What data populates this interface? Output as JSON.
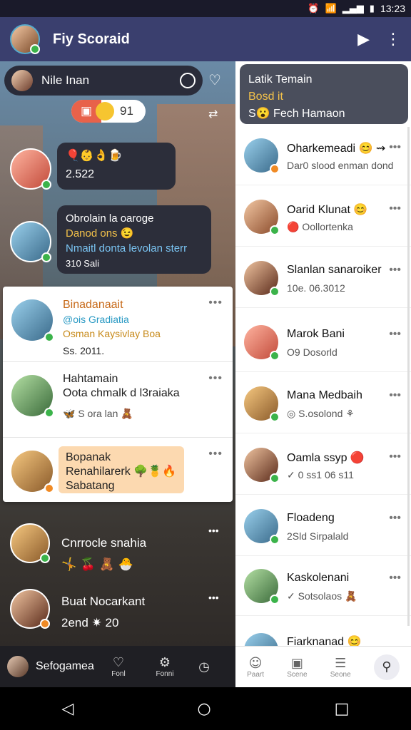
{
  "status": {
    "time": "13:23"
  },
  "header": {
    "title": "Fiy Scoraid"
  },
  "left": {
    "search_label": "Nile Inan",
    "reaction_count": "91",
    "msg1": {
      "line1": "🎈👶👌🍺",
      "line2": "2.522"
    },
    "msg2": {
      "line1": "Obrolain la oaroge",
      "line2": "Danod ons 😉",
      "line3": "Nmaitl donta levolan sterr",
      "line4": "310 Sali"
    },
    "cards": [
      {
        "l1": "Binadanaait",
        "l2": "@ois Gradiatia",
        "l3": "Osman Kaysivlay Boa",
        "l4": "Ss. 2011."
      },
      {
        "l1": "Hahtamain",
        "l2": "Oota chmalk d l3raiaka",
        "l3": "🦋 S ora lan 🧸"
      },
      {
        "l1": "Bopanak",
        "l2": "Renahilarerk 🌳🍍🔥",
        "l3": "Sabatang"
      }
    ],
    "chat1": {
      "name": "Cnrrocle snahia",
      "sub": "🤸 🍒 🧸 🐣"
    },
    "chat2": {
      "name": "Buat Nocarkant",
      "sub": "2end ✷ 20"
    },
    "footer": {
      "name": "Sefogamea",
      "tab1": "Fonl",
      "tab2": "Fonni"
    }
  },
  "right": {
    "head": {
      "title": "Latik Temain",
      "l2": "Bosd it",
      "l3": "S😮 Fech Hamaon"
    },
    "items": [
      {
        "name": "Oharkemeadi 😊 ⇝",
        "sub": "Dar0 slood enman dond"
      },
      {
        "name": "Oarid Klunat 😊",
        "sub": "🔴 Oollortenka"
      },
      {
        "name": "Slanlan sanaroiker",
        "sub": "10e. 06.3012"
      },
      {
        "name": "Marok Bani",
        "sub": "O9 Dosorld"
      },
      {
        "name": "Mana Medbaih",
        "sub": "◎ S.osolond ⚘"
      },
      {
        "name": "Oamla ssyp 🔴",
        "sub": "✓ 0 ss1 06 s11"
      },
      {
        "name": "Floadeng",
        "sub": "2Sld Sirpalald"
      },
      {
        "name": "Kaskolenani",
        "sub": "✓ Sotsolaos 🧸"
      },
      {
        "name": "Fiarknanad 😊",
        "sub": ""
      }
    ],
    "footer": {
      "t1": "Paart",
      "t2": "Scene",
      "t3": "Seone"
    }
  }
}
